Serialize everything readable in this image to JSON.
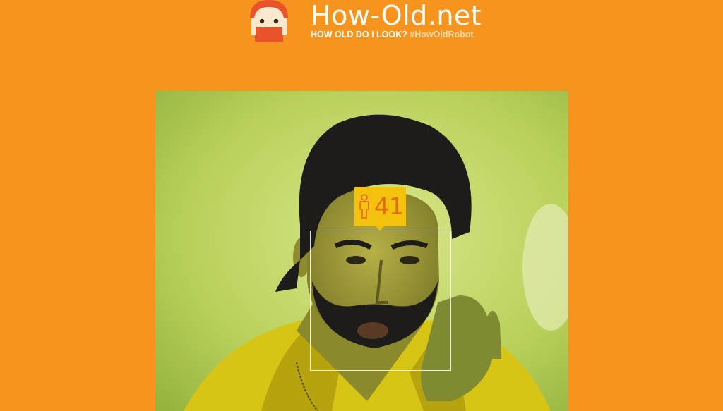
{
  "header": {
    "title": "How-Old.net",
    "subtitle_question": "HOW OLD DO I LOOK?",
    "subtitle_hashtag": "#HowOldRobot",
    "logo_icon": "robot-face-icon"
  },
  "result": {
    "age": "41",
    "gender_icon": "male-person-icon"
  },
  "colors": {
    "background": "#f7941d",
    "badge": "#f3c10e",
    "badge_text": "#e46a1a",
    "logo_accent": "#e8532a"
  }
}
